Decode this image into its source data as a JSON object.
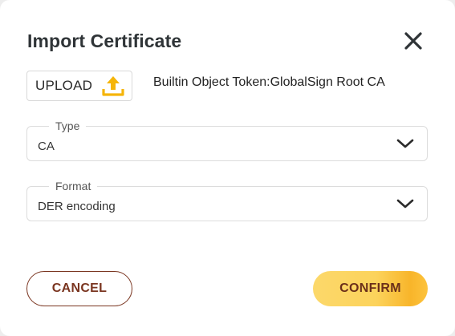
{
  "dialog": {
    "title": "Import Certificate",
    "close_icon": "close-icon"
  },
  "upload": {
    "label": "UPLOAD",
    "icon": "upload-icon",
    "icon_color": "#f5b50a",
    "file_name": "Builtin Object Token:GlobalSign Root CA"
  },
  "type_field": {
    "legend": "Type",
    "value": "CA",
    "icon": "chevron-down-icon"
  },
  "format_field": {
    "legend": "Format",
    "value": "DER encoding",
    "icon": "chevron-down-icon"
  },
  "actions": {
    "cancel_label": "CANCEL",
    "confirm_label": "CONFIRM",
    "cancel_color": "#7a3520",
    "confirm_color": "#fcd35c"
  }
}
